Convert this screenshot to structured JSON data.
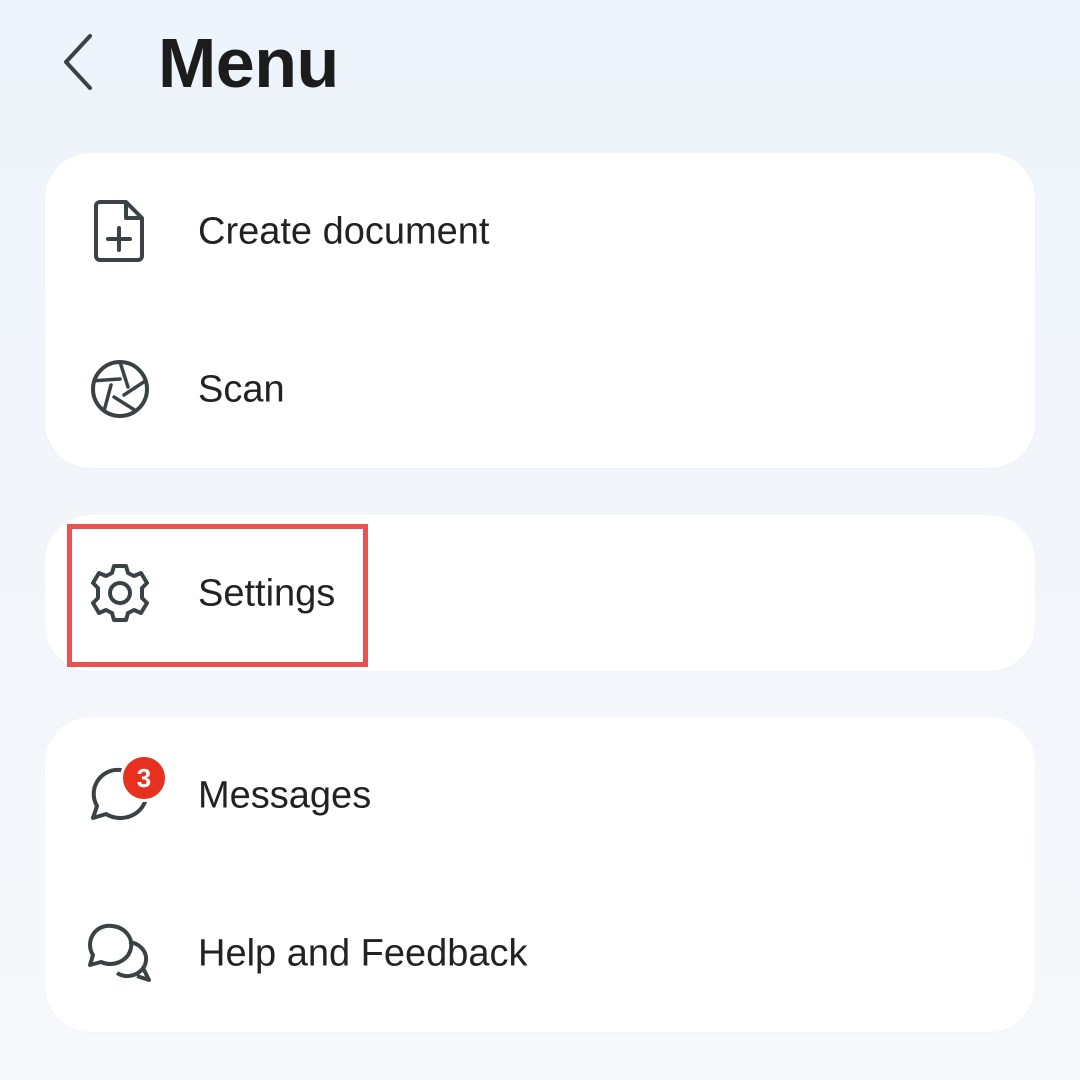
{
  "header": {
    "title": "Menu",
    "back_icon": "chevron-left-icon"
  },
  "cards": [
    {
      "items": [
        {
          "label": "Create document",
          "icon": "file-plus-icon"
        },
        {
          "label": "Scan",
          "icon": "aperture-icon"
        }
      ]
    },
    {
      "items": [
        {
          "label": "Settings",
          "icon": "gear-icon"
        }
      ]
    },
    {
      "items": [
        {
          "label": "Messages",
          "icon": "chat-bubble-icon",
          "badge": "3"
        },
        {
          "label": "Help and Feedback",
          "icon": "chat-bubbles-icon"
        }
      ]
    }
  ],
  "colors": {
    "badge": "#e8301e",
    "highlight": "#e85352",
    "icon_stroke": "#3a4246",
    "text": "#222222"
  }
}
